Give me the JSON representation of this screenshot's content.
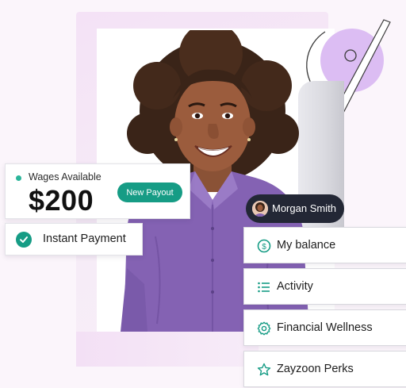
{
  "wages": {
    "label": "Wages Available",
    "amount": "$200",
    "payout_button": "New Payout"
  },
  "instant_payment": {
    "label": "Instant Payment",
    "icon": "check-icon"
  },
  "user": {
    "name": "Morgan Smith",
    "avatar": "avatar-icon"
  },
  "menu": {
    "items": [
      {
        "label": "My balance",
        "icon": "dollar-circle-icon"
      },
      {
        "label": "Activity",
        "icon": "list-icon"
      },
      {
        "label": "Financial Wellness",
        "icon": "gear-icon"
      },
      {
        "label": "Zayzoon Perks",
        "icon": "star-icon"
      }
    ]
  },
  "colors": {
    "accent": "#169c85",
    "accent_dot": "#2bb59a",
    "pill_dark": "#232735",
    "background": "#fbf5fb",
    "lavender": "#d9b8f0",
    "shirt": "#8462b3"
  }
}
